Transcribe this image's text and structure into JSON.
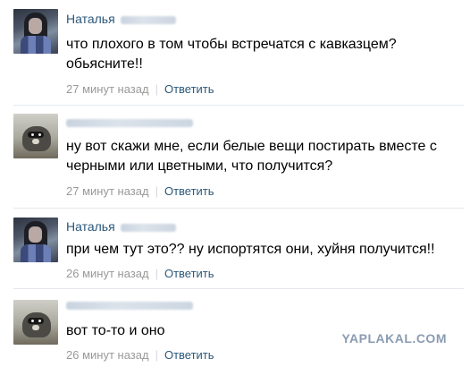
{
  "comments": [
    {
      "author": "Наталья",
      "text": "что плохого в том чтобы встречатся с кавказцем?\nобьясните!!",
      "time": "27 минут назад",
      "reply": "Ответить"
    },
    {
      "author": "",
      "text": "ну вот скажи мне, если белые вещи постирать вместе с\nчерными или цветными, что получится?",
      "time": "27 минут назад",
      "reply": "Ответить"
    },
    {
      "author": "Наталья",
      "text": "при чем тут это?? ну испортятся они, хуйня получится!!",
      "time": "26 минут назад",
      "reply": "Ответить"
    },
    {
      "author": "",
      "text": "вот то-то и оно",
      "time": "26 минут назад",
      "reply": "Ответить"
    }
  ],
  "watermark": "YAPLAKAL.COM"
}
